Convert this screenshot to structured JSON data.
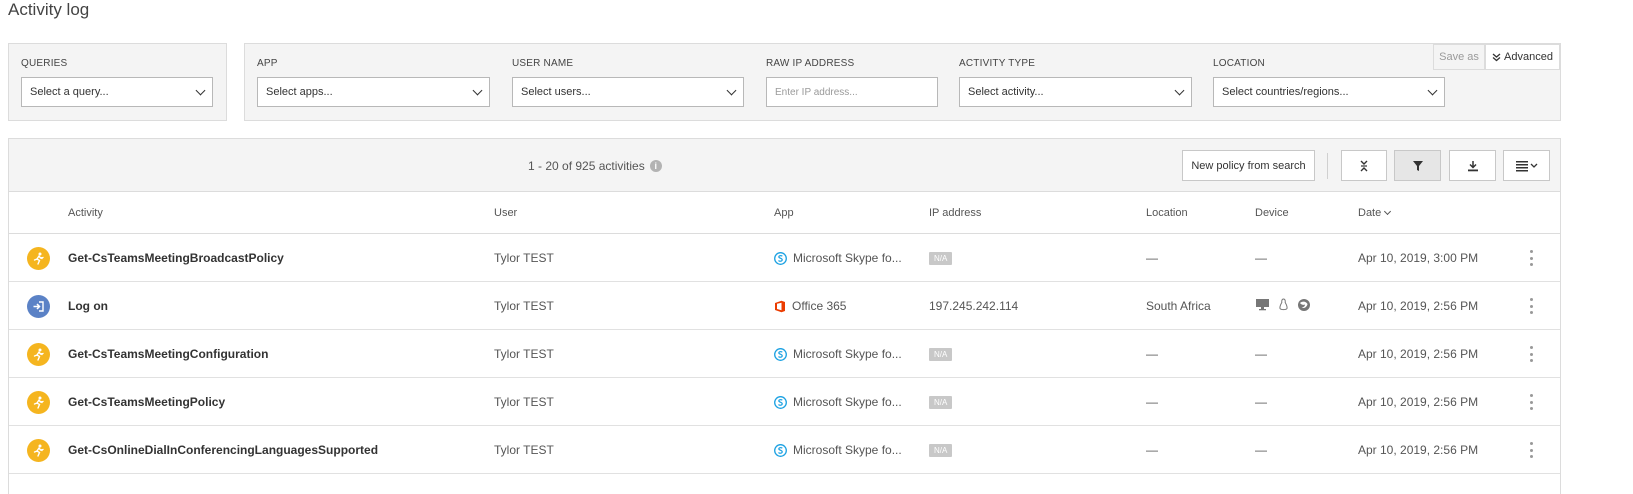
{
  "page": {
    "title": "Activity log"
  },
  "queries": {
    "label": "QUERIES",
    "select": "Select a query..."
  },
  "filters": {
    "app": {
      "label": "APP",
      "select": "Select apps..."
    },
    "user": {
      "label": "USER NAME",
      "select": "Select users..."
    },
    "ip": {
      "label": "RAW IP ADDRESS",
      "placeholder": "Enter IP address..."
    },
    "activity": {
      "label": "ACTIVITY TYPE",
      "select": "Select activity..."
    },
    "location": {
      "label": "LOCATION",
      "select": "Select countries/regions..."
    },
    "save_as": "Save as",
    "advanced": "Advanced"
  },
  "toolbar": {
    "count": "1 - 20 of 925 activities",
    "info": "i",
    "new_policy": "New policy from search"
  },
  "columns": {
    "activity": "Activity",
    "user": "User",
    "app": "App",
    "ip": "IP address",
    "location": "Location",
    "device": "Device",
    "date": "Date"
  },
  "rows": [
    {
      "icon": "run",
      "activity": "Get-CsTeamsMeetingBroadcastPolicy",
      "user": "Tylor TEST",
      "app_icon": "skype",
      "app": "Microsoft Skype fo...",
      "ip": "N/A",
      "ip_na": true,
      "location": "—",
      "device": "—",
      "date": "Apr 10, 2019, 3:00 PM"
    },
    {
      "icon": "login",
      "activity": "Log on",
      "user": "Tylor TEST",
      "app_icon": "office",
      "app": "Office 365",
      "ip": "197.245.242.114",
      "ip_na": false,
      "location": "South Africa",
      "device": "icons",
      "date": "Apr 10, 2019, 2:56 PM"
    },
    {
      "icon": "run",
      "activity": "Get-CsTeamsMeetingConfiguration",
      "user": "Tylor TEST",
      "app_icon": "skype",
      "app": "Microsoft Skype fo...",
      "ip": "N/A",
      "ip_na": true,
      "location": "—",
      "device": "—",
      "date": "Apr 10, 2019, 2:56 PM"
    },
    {
      "icon": "run",
      "activity": "Get-CsTeamsMeetingPolicy",
      "user": "Tylor TEST",
      "app_icon": "skype",
      "app": "Microsoft Skype fo...",
      "ip": "N/A",
      "ip_na": true,
      "location": "—",
      "device": "—",
      "date": "Apr 10, 2019, 2:56 PM"
    },
    {
      "icon": "run",
      "activity": "Get-CsOnlineDialInConferencingLanguagesSupported",
      "user": "Tylor TEST",
      "app_icon": "skype",
      "app": "Microsoft Skype fo...",
      "ip": "N/A",
      "ip_na": true,
      "location": "—",
      "device": "—",
      "date": "Apr 10, 2019, 2:56 PM"
    }
  ],
  "colors": {
    "run": "#f5b51f",
    "login": "#5b82c6",
    "skype": "#1ba1e2",
    "office": "#eb3c00"
  }
}
